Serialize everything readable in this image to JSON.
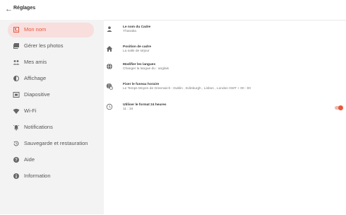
{
  "header": {
    "back_icon": "arrow-left-icon",
    "title": "Réglages"
  },
  "sidebar": {
    "items": [
      {
        "label": "Mon nom",
        "icon": "name-card-icon",
        "active": true
      },
      {
        "label": "Gérer les photos",
        "icon": "photos-icon"
      },
      {
        "label": "Mes amis",
        "icon": "friends-icon"
      },
      {
        "label": "Affichage",
        "icon": "display-icon"
      },
      {
        "label": "Diapositive",
        "icon": "slideshow-icon"
      },
      {
        "label": "Wi-Fi",
        "icon": "wifi-icon"
      },
      {
        "label": "Notifications",
        "icon": "notifications-icon"
      },
      {
        "label": "Sauvegarde et restauration",
        "icon": "backup-icon"
      },
      {
        "label": "Aide",
        "icon": "help-icon"
      },
      {
        "label": "Information",
        "icon": "info-icon"
      }
    ]
  },
  "settings": {
    "frame_name": {
      "title": "Le nom du Cadre",
      "value": "Yhanaka",
      "icon": "person-icon"
    },
    "frame_position": {
      "title": "Position de cadre",
      "value": "La salle de séjour",
      "icon": "home-icon"
    },
    "language": {
      "title": "Modifier les langues",
      "value": "Changer la langue du : anglais",
      "icon": "globe-icon"
    },
    "timezone": {
      "title": "Fixer le fuseau horaire",
      "value": "Le Temps Moyen de Greenwich : Dublin , Edinburgh , Lisbon , London GMT + 00 : 00",
      "icon": "globe-clock-icon"
    },
    "clock_24h": {
      "title": "Utiliser le format 24 heures",
      "value": "11 : 34",
      "icon": "clock-icon",
      "enabled": true
    }
  },
  "colors": {
    "accent": "#e8583c",
    "active_bg": "#f9dede",
    "sidebar_bg": "#f3f3f3"
  }
}
